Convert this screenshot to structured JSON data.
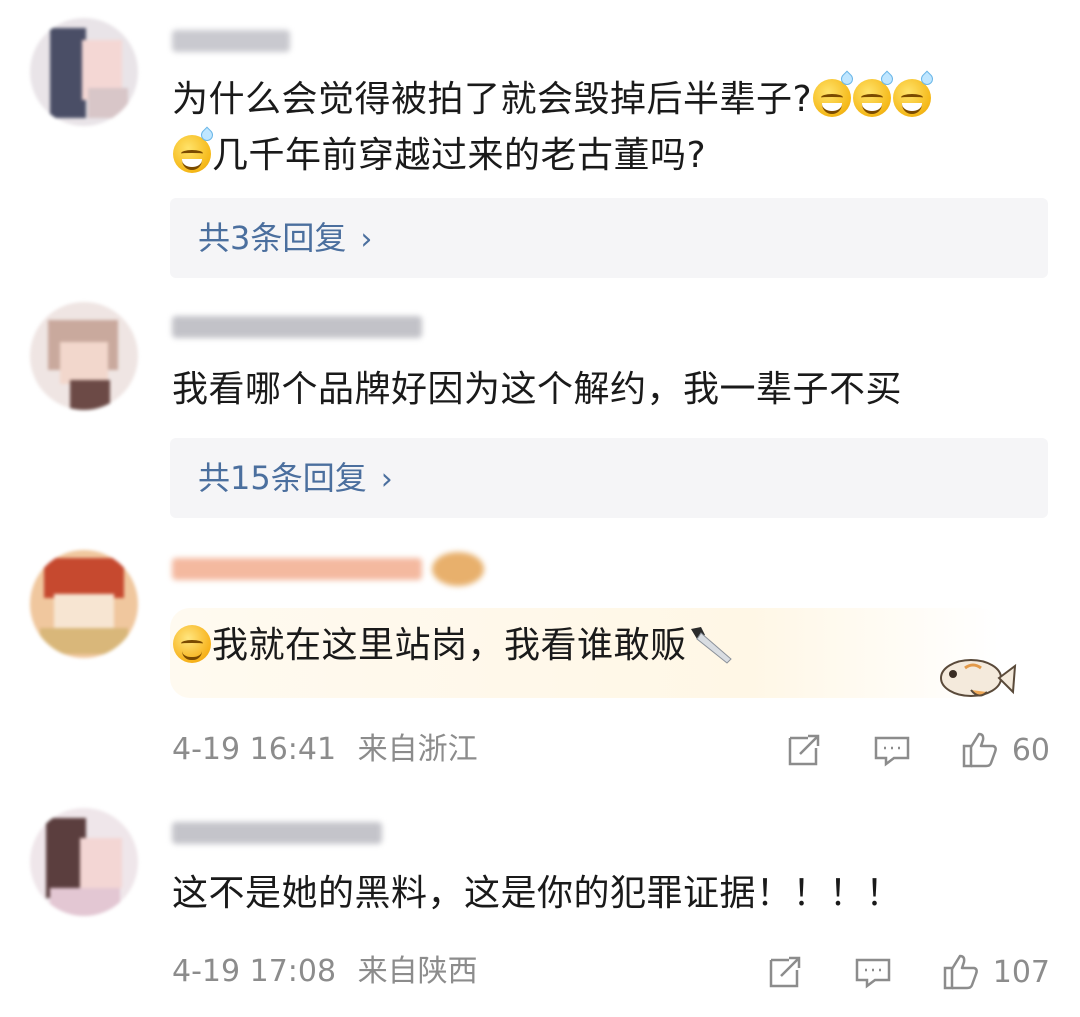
{
  "comments": [
    {
      "line1": "为什么会觉得被拍了就会毁掉后半辈子?",
      "line2": "几千年前穿越过来的老古董吗?",
      "reply_label": "共3条回复",
      "chevron": "›"
    },
    {
      "line1": "我看哪个品牌好因为这个解约，我一辈子不买",
      "reply_label": "共15条回复",
      "chevron": "›"
    },
    {
      "line1": "我就在这里站岗，我看谁敢贩",
      "date": "4-19 16:41",
      "location": "来自浙江",
      "likes": "60"
    },
    {
      "line1": "这不是她的黑料，这是你的犯罪证据！！！！",
      "date": "4-19 17:08",
      "location": "来自陕西",
      "likes": "107"
    }
  ],
  "icons": {
    "share": "share-icon",
    "comment": "comment-icon",
    "like": "thumbs-up-icon",
    "emoji_sweat": "sweat-smile-emoji-icon",
    "emoji_blush": "blush-emoji-icon",
    "knife": "knife-emoji-icon",
    "fish": "fish-sticker-icon"
  },
  "colors": {
    "link": "#4b6f9e",
    "meta": "#8c8c8c",
    "reply_bg": "#f5f5f7"
  }
}
